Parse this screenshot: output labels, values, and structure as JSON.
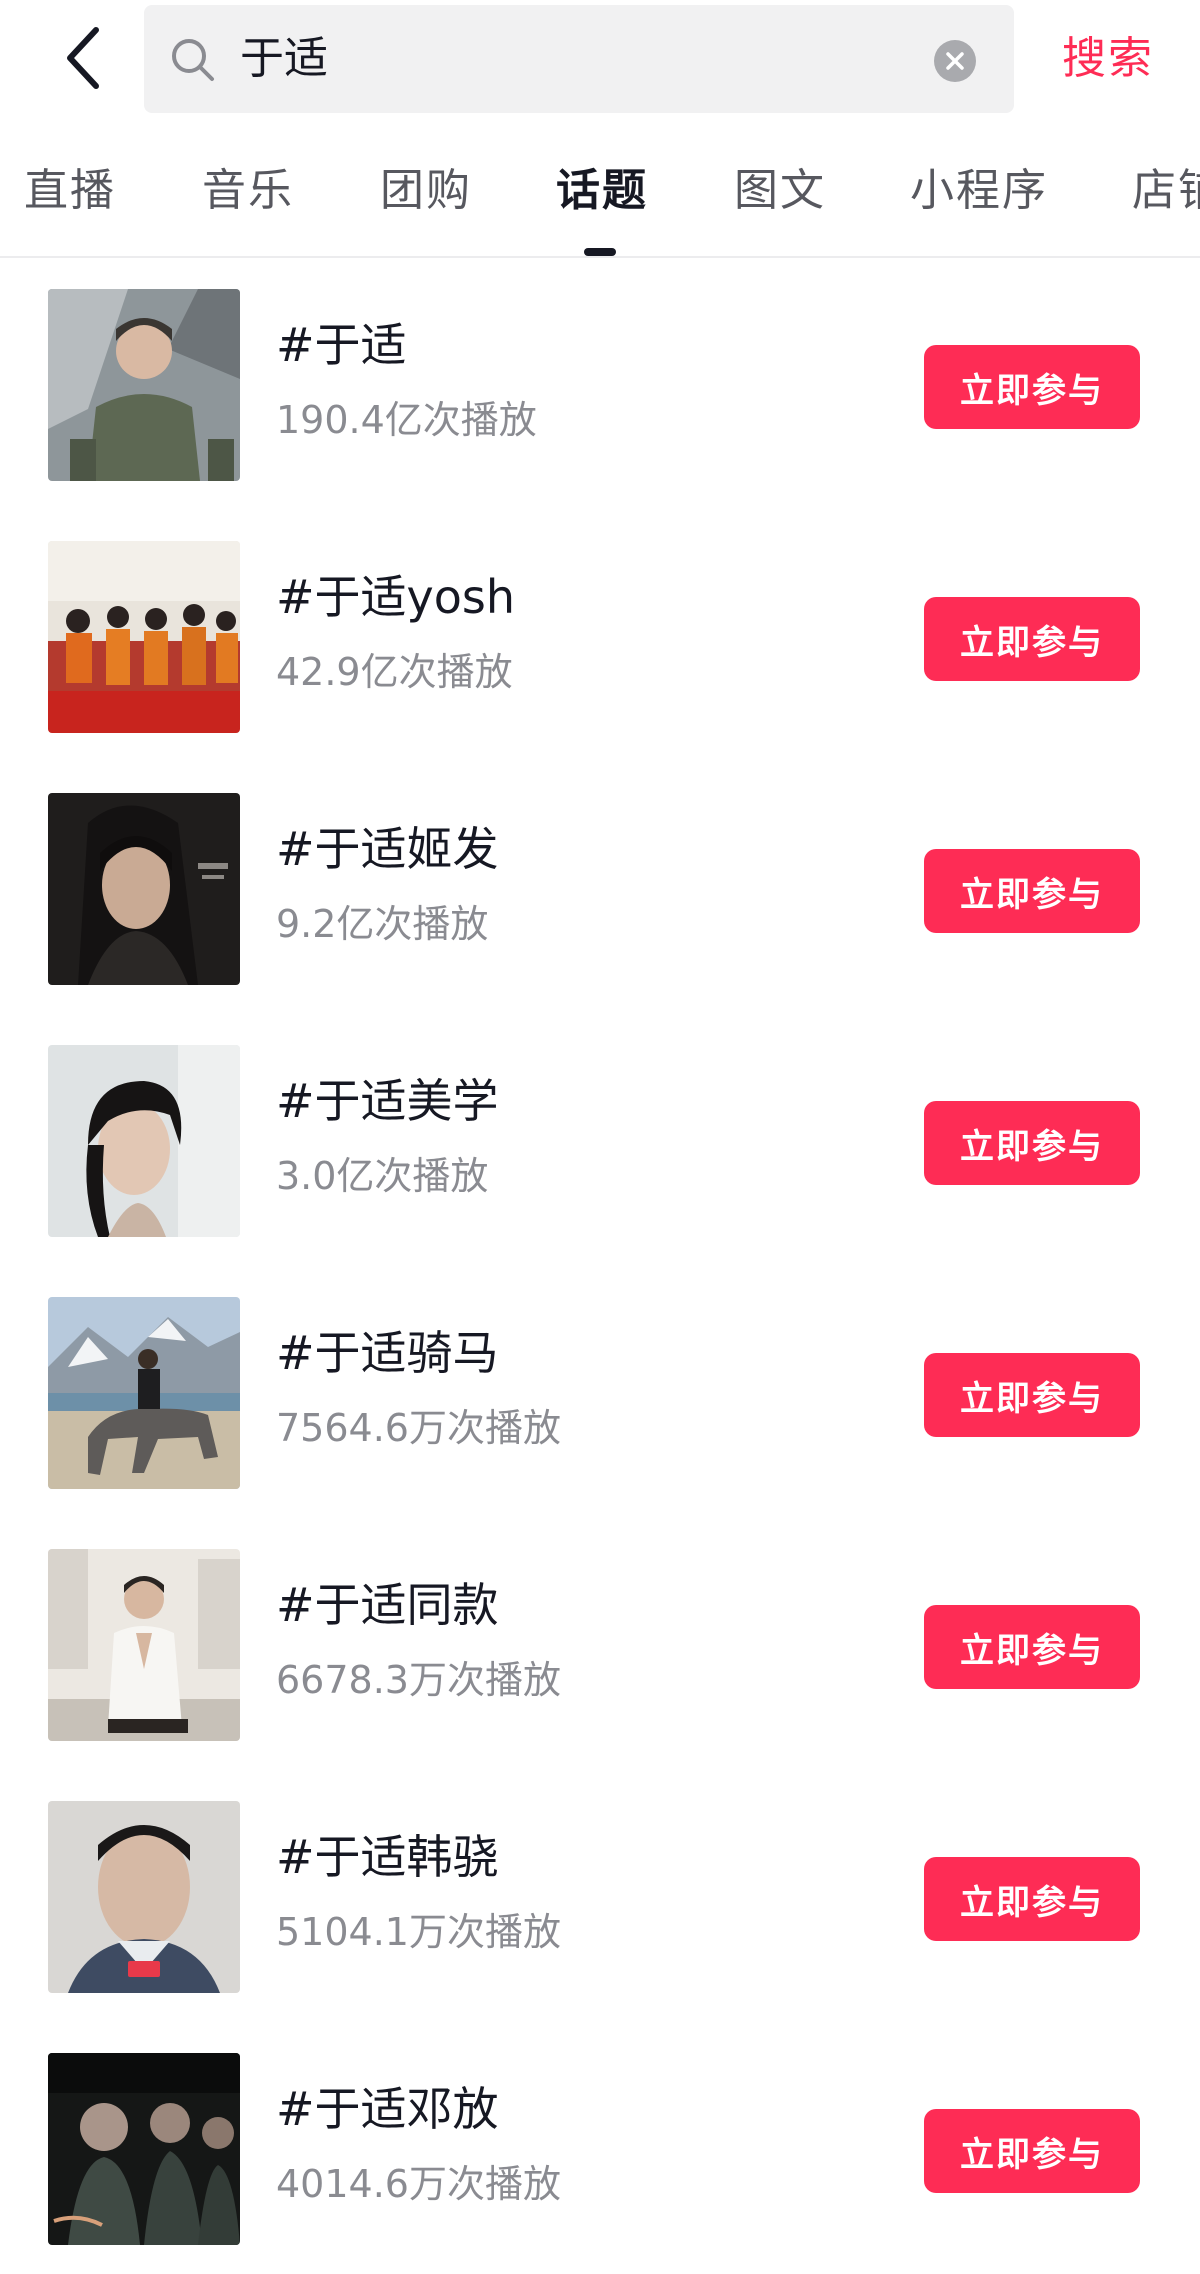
{
  "search": {
    "query": "于适",
    "submit_label": "搜索"
  },
  "icons": {
    "back": "chevron-left-icon",
    "search": "magnifier-icon",
    "clear": "close-circle-icon"
  },
  "colors": {
    "accent": "#fe2c55",
    "text_primary": "#161823",
    "text_secondary": "#8a8b91",
    "search_bg": "#f1f1f2"
  },
  "tabs": [
    {
      "label": "直播",
      "active": false
    },
    {
      "label": "音乐",
      "active": false
    },
    {
      "label": "团购",
      "active": false
    },
    {
      "label": "话题",
      "active": true
    },
    {
      "label": "图文",
      "active": false
    },
    {
      "label": "小程序",
      "active": false
    },
    {
      "label": "店铺",
      "active": false
    }
  ],
  "topics": [
    {
      "title": "#于适",
      "count": "190.4亿次播放",
      "action": "立即参与"
    },
    {
      "title": "#于适yosh",
      "count": "42.9亿次播放",
      "action": "立即参与"
    },
    {
      "title": "#于适姬发",
      "count": "9.2亿次播放",
      "action": "立即参与"
    },
    {
      "title": "#于适美学",
      "count": "3.0亿次播放",
      "action": "立即参与"
    },
    {
      "title": "#于适骑马",
      "count": "7564.6万次播放",
      "action": "立即参与"
    },
    {
      "title": "#于适同款",
      "count": "6678.3万次播放",
      "action": "立即参与"
    },
    {
      "title": "#于适韩骁",
      "count": "5104.1万次播放",
      "action": "立即参与"
    },
    {
      "title": "#于适邓放",
      "count": "4014.6万次播放",
      "action": "立即参与"
    }
  ]
}
